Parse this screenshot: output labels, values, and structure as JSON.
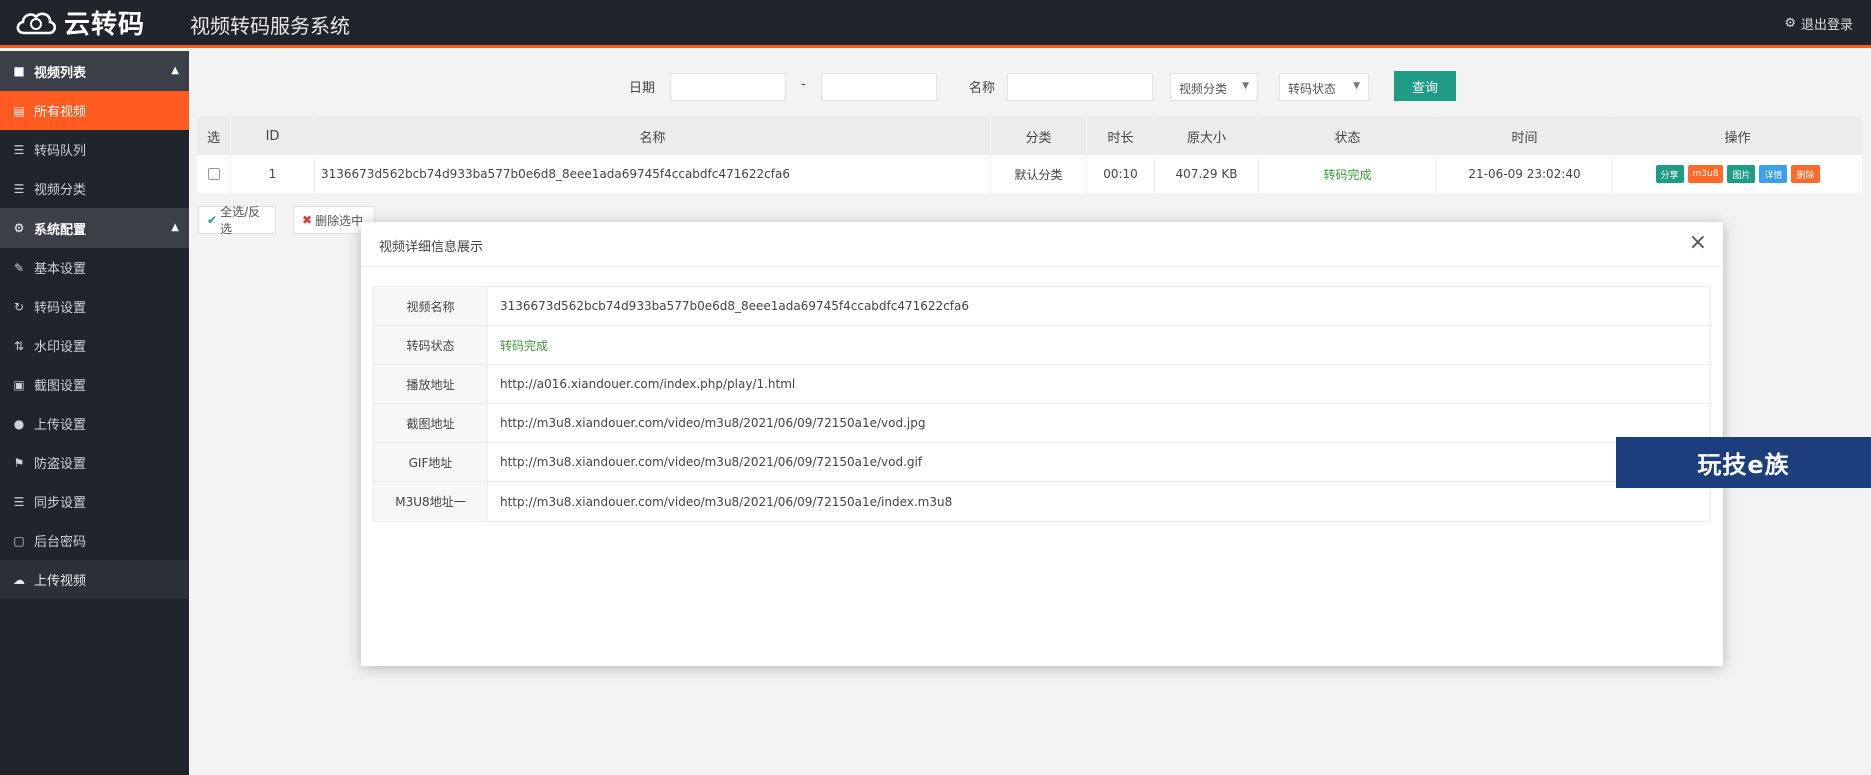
{
  "brand": {
    "logo_text": "云转码",
    "system_title": "视频转码服务系统",
    "logout": "退出登录"
  },
  "sidebar": {
    "groups": [
      {
        "label": "视频列表",
        "items": [
          "所有视频",
          "转码队列",
          "视频分类"
        ]
      },
      {
        "label": "系统配置",
        "items": [
          "基本设置",
          "转码设置",
          "水印设置",
          "截图设置",
          "上传设置",
          "防盗设置",
          "同步设置",
          "后台密码"
        ]
      }
    ],
    "upload": "上传视频"
  },
  "filters": {
    "date_label": "日期",
    "date_sep": "-",
    "name_label": "名称",
    "category_select": "视频分类",
    "status_select": "转码状态",
    "query_btn": "查询"
  },
  "table": {
    "headers": [
      "选",
      "ID",
      "名称",
      "分类",
      "时长",
      "原大小",
      "状态",
      "时间",
      "操作"
    ],
    "rows": [
      {
        "id": "1",
        "name": "3136673d562bcb74d933ba577b0e6d8_8eee1ada69745f4ccabdfc471622cfa6",
        "category": "默认分类",
        "duration": "00:10",
        "size": "407.29 KB",
        "status": "转码完成",
        "time": "21-06-09 23:02:40",
        "ops": [
          "分享",
          "m3u8",
          "图片",
          "详情",
          "删除"
        ]
      }
    ]
  },
  "bulk": {
    "select_all": "全选/反选",
    "delete_selected": "删除选中"
  },
  "modal": {
    "title": "视频详细信息展示",
    "rows": [
      {
        "label": "视频名称",
        "value": "3136673d562bcb74d933ba577b0e6d8_8eee1ada69745f4ccabdfc471622cfa6"
      },
      {
        "label": "转码状态",
        "value": "转码完成"
      },
      {
        "label": "播放地址",
        "value": "http://a016.xiandouer.com/index.php/play/1.html"
      },
      {
        "label": "截图地址",
        "value": "http://m3u8.xiandouer.com/video/m3u8/2021/06/09/72150a1e/vod.jpg"
      },
      {
        "label": "GIF地址",
        "value": "http://m3u8.xiandouer.com/video/m3u8/2021/06/09/72150a1e/vod.gif"
      },
      {
        "label": "M3U8地址一",
        "value": "http://m3u8.xiandouer.com/video/m3u8/2021/06/09/72150a1e/index.m3u8"
      }
    ]
  },
  "watermark": "玩技e族",
  "colors": {
    "accent": "#ff5a1f",
    "sidebar_bg": "#20242b",
    "primary_btn": "#1f9b86",
    "success": "#3a9b3a"
  },
  "icons": {
    "sidebar_group_1": "video-icon",
    "sidebar_group_2": "gear-icon",
    "sidebar_items": [
      "list-icon",
      "list-icon",
      "list-icon",
      "edit-icon",
      "refresh-icon",
      "transfer-icon",
      "image-icon",
      "user-icon",
      "flag-icon",
      "list-icon",
      "file-icon"
    ],
    "upload": "cloud-upload-icon"
  }
}
